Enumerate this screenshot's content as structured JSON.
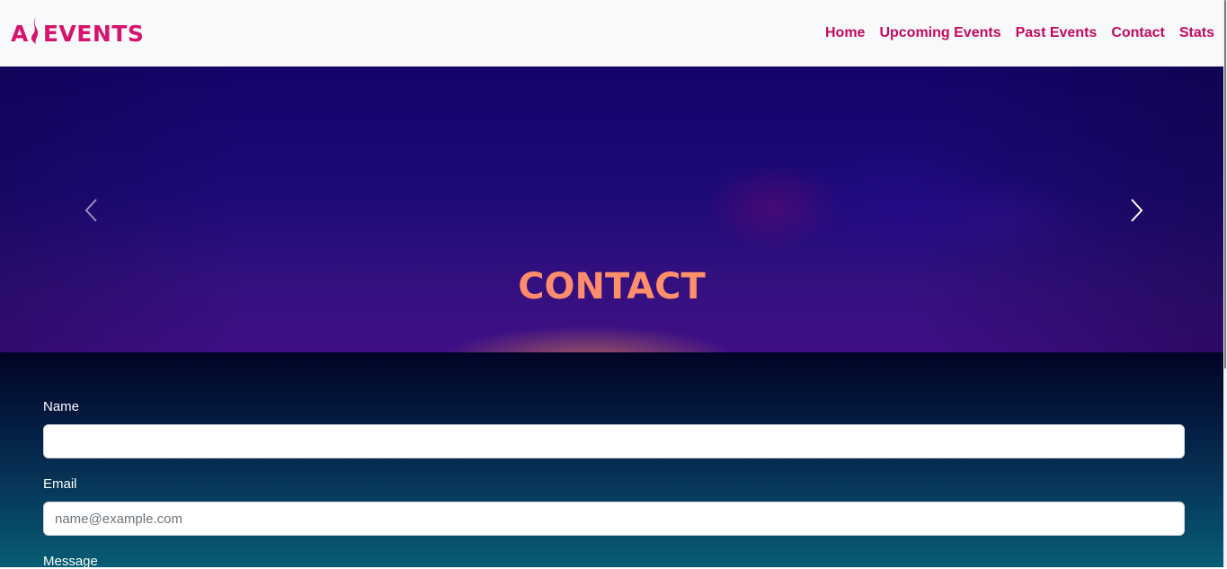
{
  "navbar": {
    "logo": {
      "prefix": "A",
      "suffix": "EVENTS",
      "color": "#d6136f"
    },
    "links": [
      {
        "label": "Home"
      },
      {
        "label": "Upcoming Events"
      },
      {
        "label": "Past Events"
      },
      {
        "label": "Contact"
      },
      {
        "label": "Stats"
      }
    ],
    "link_color": "#c40a5f"
  },
  "hero": {
    "title": "CONTACT",
    "prev_icon": "chevron-left-icon",
    "next_icon": "chevron-right-icon"
  },
  "form": {
    "name": {
      "label": "Name",
      "value": "",
      "placeholder": ""
    },
    "email": {
      "label": "Email",
      "value": "",
      "placeholder": "name@example.com"
    },
    "message": {
      "label": "Message"
    }
  }
}
